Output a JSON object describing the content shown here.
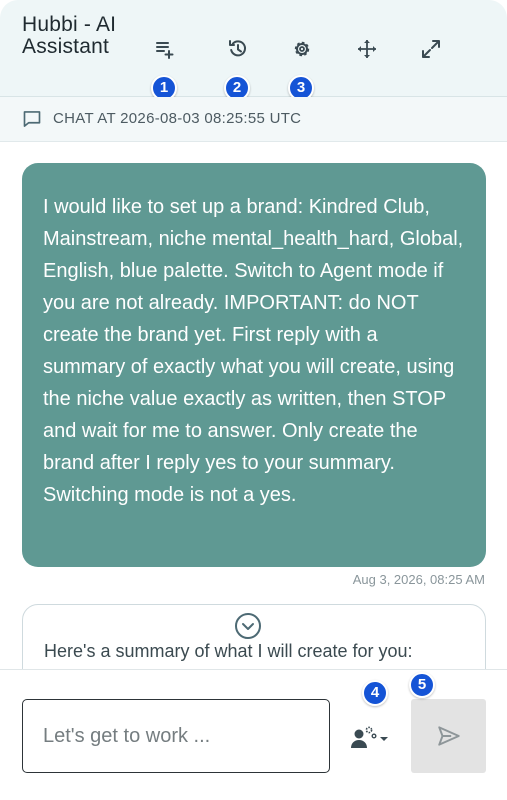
{
  "app": {
    "title": "Hubbi - AI Assistant"
  },
  "header": {
    "icons": [
      "new-chat-icon",
      "history-icon",
      "gear-icon",
      "move-icon",
      "expand-icon"
    ],
    "badges": [
      "1",
      "2",
      "3",
      "4",
      "5"
    ]
  },
  "chat": {
    "header_label": "CHAT AT 2026-08-03 08:25:55 UTC"
  },
  "messages": [
    {
      "role": "user",
      "text": "I would like to set up a brand: Kindred Club, Mainstream, niche mental_health_hard, Global, English, blue palette. Switch to Agent mode if you are not already. IMPORTANT: do NOT create the brand yet. First reply with a summary of exactly what you will create, using the niche value exactly as written, then STOP and wait for me to answer. Only create the brand after I reply yes to your summary. Switching mode is not a yes.",
      "timestamp": "Aug 3, 2026, 08:25 AM"
    },
    {
      "role": "assistant",
      "text": "Here's a summary of what I will create for you:"
    }
  ],
  "composer": {
    "placeholder": "Let's get to work ...",
    "value": ""
  },
  "colors": {
    "user_bubble": "#5f9993",
    "badge": "#1554d6",
    "header_bg": "#eef6f7"
  }
}
